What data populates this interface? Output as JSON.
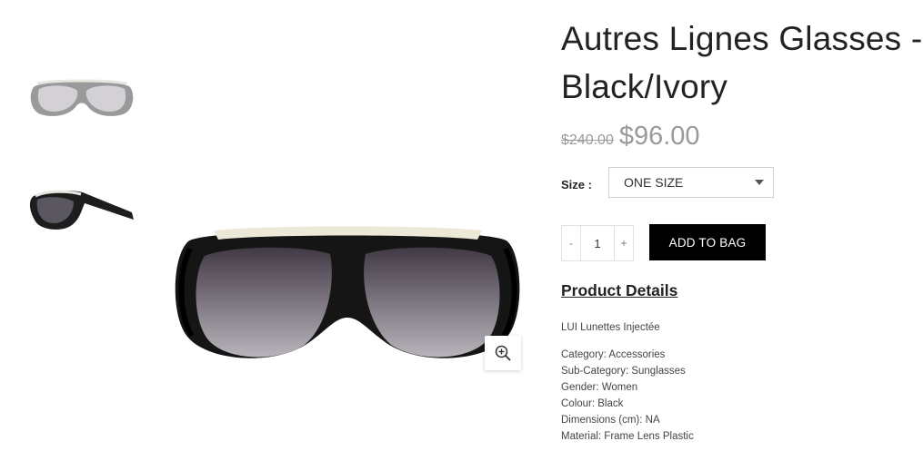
{
  "product": {
    "title": "Autres Lignes Glasses - Black/Ivory",
    "old_price": "$240.00",
    "new_price": "$96.00"
  },
  "size": {
    "label": "Size :",
    "selected": "ONE SIZE"
  },
  "quantity": {
    "minus": "-",
    "value": "1",
    "plus": "+"
  },
  "add_to_bag": "ADD TO BAG",
  "details": {
    "heading": "Product Details",
    "name": "LUI Lunettes Injectée",
    "items": [
      "Category: Accessories",
      "Sub-Category: Sunglasses",
      "Gender: Women",
      "Colour: Black",
      "Dimensions (cm): NA",
      "Material: Frame Lens Plastic"
    ]
  },
  "icons": {
    "zoom": "zoom-in-icon"
  }
}
